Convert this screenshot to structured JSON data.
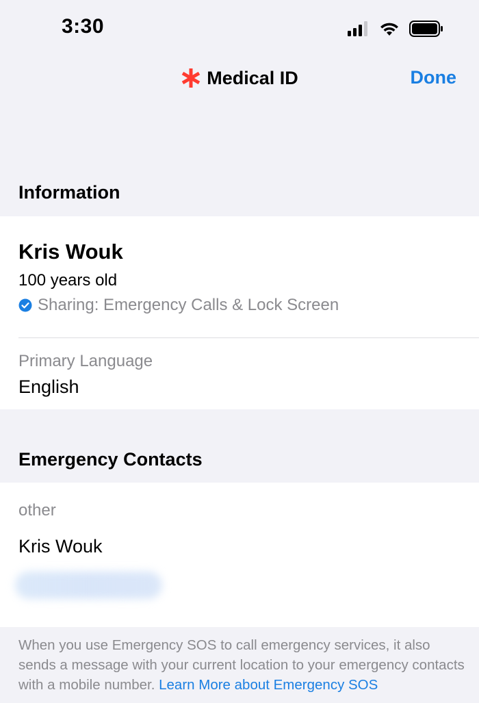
{
  "status_bar": {
    "time": "3:30",
    "icons": [
      "cellular-signal-icon",
      "wifi-icon",
      "battery-icon"
    ]
  },
  "nav": {
    "title": "Medical ID",
    "title_icon": "medical-star-icon",
    "done_label": "Done"
  },
  "information": {
    "header": "Information",
    "name": "Kris Wouk",
    "age": "100 years old",
    "sharing": "Sharing: Emergency Calls & Lock Screen",
    "primary_language_label": "Primary Language",
    "primary_language_value": "English"
  },
  "emergency_contacts": {
    "header": "Emergency Contacts",
    "contacts": [
      {
        "relationship": "other",
        "name": "Kris Wouk"
      }
    ]
  },
  "footer": {
    "text": "When you use Emergency SOS to call emergency services, it also sends a message with your current location to your emergency contacts with a mobile number. ",
    "link": "Learn More about Emergency SOS"
  },
  "colors": {
    "accent": "#1a7fe2",
    "medical_red": "#ff3b30",
    "background": "#f2f2f7",
    "secondary_text": "#8a8a8e"
  }
}
